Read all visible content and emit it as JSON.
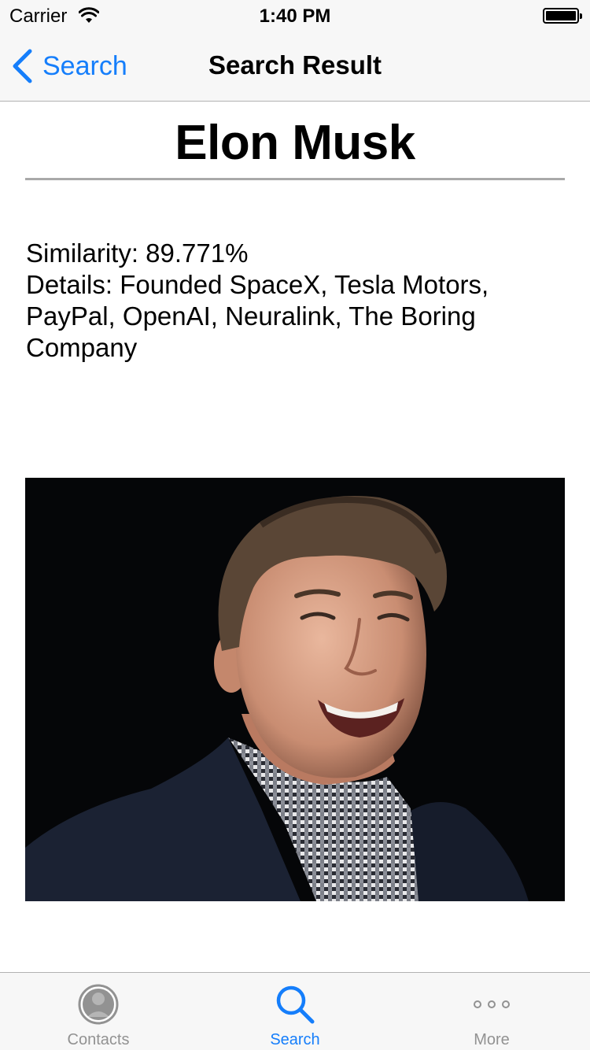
{
  "status_bar": {
    "carrier": "Carrier",
    "time": "1:40 PM"
  },
  "nav": {
    "back_label": "Search",
    "title": "Search Result"
  },
  "result": {
    "name": "Elon Musk",
    "similarity": "Similarity: 89.771%",
    "details": "Details: Founded SpaceX, Tesla Motors, PayPal, OpenAI, Neuralink, The Boring Company"
  },
  "tabs": [
    {
      "label": "Contacts",
      "icon": "contacts-icon",
      "active": false
    },
    {
      "label": "Search",
      "icon": "search-icon",
      "active": true
    },
    {
      "label": "More",
      "icon": "more-icon",
      "active": false
    }
  ],
  "colors": {
    "accent": "#157efb",
    "inactive_tab": "#929292",
    "bar_background": "#f7f7f7"
  }
}
